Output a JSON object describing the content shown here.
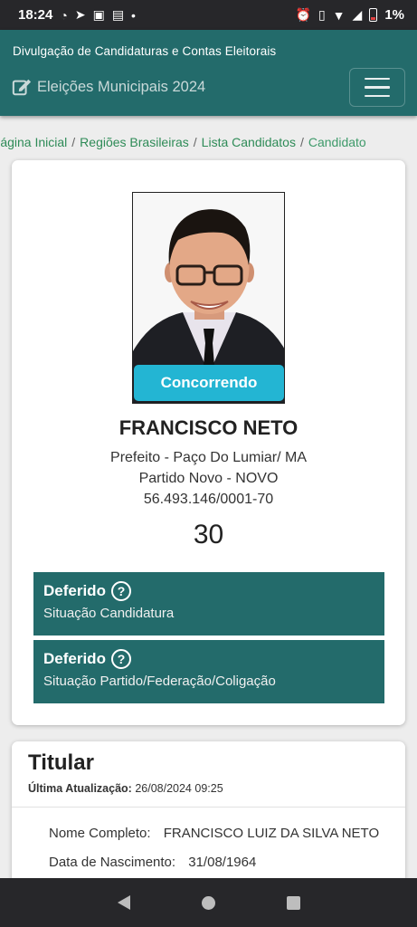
{
  "status_bar": {
    "time": "18:24",
    "battery_percent": "1%",
    "icons": [
      "whatsapp-icon",
      "telegram-icon",
      "instagram-icon",
      "facebook-icon",
      "alarm-icon",
      "vibrate-icon",
      "wifi-icon",
      "signal-icon",
      "battery-icon"
    ]
  },
  "header": {
    "subtitle": "Divulgação de Candidaturas e Contas Eleitorais",
    "brand": "Eleições Municipais 2024"
  },
  "breadcrumb": {
    "items": [
      "Página Inicial",
      "Regiões Brasileiras",
      "Lista Candidatos"
    ],
    "current": "Candidato"
  },
  "candidate": {
    "status_chip": "Concorrendo",
    "name": "FRANCISCO NETO",
    "office": "Prefeito - Paço Do Lumiar/ MA",
    "party": "Partido Novo - NOVO",
    "cnpj": "56.493.146/0001-70",
    "number": "30",
    "situations": [
      {
        "title": "Deferido",
        "label": "Situação Candidatura"
      },
      {
        "title": "Deferido",
        "label": "Situação Partido/Federação/Coligação"
      }
    ]
  },
  "titular": {
    "heading": "Titular",
    "update_label": "Última Atualização:",
    "update_value": "26/08/2024 09:25",
    "rows": [
      {
        "key": "Nome Completo:",
        "value": "FRANCISCO LUIZ DA SILVA NETO"
      },
      {
        "key": "Data de Nascimento:",
        "value": "31/08/1964"
      }
    ]
  },
  "colors": {
    "primary": "#236b6b",
    "chip": "#23b5d3",
    "breadcrumb_link": "#2e8b57"
  }
}
